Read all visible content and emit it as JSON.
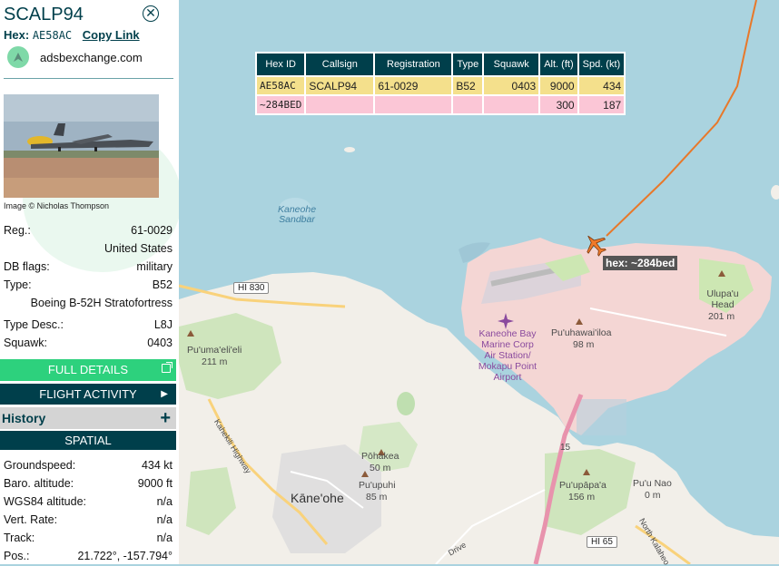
{
  "aircraft": {
    "callsign": "SCALP94",
    "hex_label": "Hex:",
    "hex": "AE58AC",
    "copy_link": "Copy Link",
    "source": "adsbexchange.com",
    "photo_credit": "Image © Nicholas Thompson",
    "close_icon": "close-icon"
  },
  "details": [
    {
      "key": "Reg.:",
      "value": "61-0029"
    },
    {
      "key": "",
      "value": "United States"
    },
    {
      "key": "DB flags:",
      "value": "military"
    },
    {
      "key": "Type:",
      "value": "B52"
    },
    {
      "key": "",
      "value": "Boeing B-52H Stratofortress"
    },
    {
      "key": "Type Desc.:",
      "value": "L8J"
    },
    {
      "key": "Squawk:",
      "value": "0403"
    }
  ],
  "buttons": {
    "full_details": "FULL DETAILS",
    "flight_activity": "FLIGHT ACTIVITY",
    "history": "History",
    "history_plus": "+",
    "spatial": "SPATIAL"
  },
  "spatial": [
    {
      "key": "Groundspeed:",
      "value": "434 kt"
    },
    {
      "key": "Baro. altitude:",
      "value": "9000 ft"
    },
    {
      "key": "WGS84 altitude:",
      "value": "n/a"
    },
    {
      "key": "Vert. Rate:",
      "value": "n/a"
    },
    {
      "key": "Track:",
      "value": "n/a"
    },
    {
      "key": "Pos.:",
      "value": "21.722°, -157.794°"
    }
  ],
  "table": {
    "headers": [
      "Hex ID",
      "Callsign",
      "Registration",
      "Type",
      "Squawk",
      "Alt. (ft)",
      "Spd. (kt)"
    ],
    "rows": [
      [
        "AE58AC",
        "SCALP94",
        "61-0029",
        "B52",
        "0403",
        "9000",
        "434"
      ],
      [
        "~284BED",
        "",
        "",
        "",
        "",
        "300",
        "187"
      ]
    ]
  },
  "map": {
    "selected_label": "hex: ~284bed",
    "labels": {
      "kaneohe_sandbar": "Kaneohe Sandbar",
      "hi830": "HI 830",
      "puumaelei": "Pu'uma'eli'eli",
      "puumaelei_elev": "211 m",
      "kaneohe_bay_airport": "Kaneohe Bay Marine Corp Air Station/ Mokapu Point Airport",
      "puuhawaiiloa": "Pu'uhawai'iloa",
      "puuhawaiiloa_elev": "98 m",
      "ulupau": "Ulupa'u Head",
      "ulupau_elev": "201 m",
      "pohakea": "Pōhakea",
      "pohakea_elev": "50 m",
      "puupuhi": "Pu'upuhi",
      "puupuhi_elev": "85 m",
      "kaneohe": "Kāne'ohe",
      "puupapaa": "Pu'upāpa'a",
      "puupapaa_elev": "156 m",
      "puunao": "Pu'u Nao",
      "puunao_elev": "0 m",
      "route15": "15",
      "hi65": "HI 65",
      "kahekili": "Kahekili Highway",
      "drive": "Drive",
      "north_kalaheo": "North Kalaheo"
    }
  },
  "colors": {
    "primary": "#003f4b",
    "green": "#2dd17d",
    "row_selected": "#f4e08c",
    "row_other": "#fbc6d6",
    "track": "#e8782a",
    "water": "#aad3df"
  }
}
